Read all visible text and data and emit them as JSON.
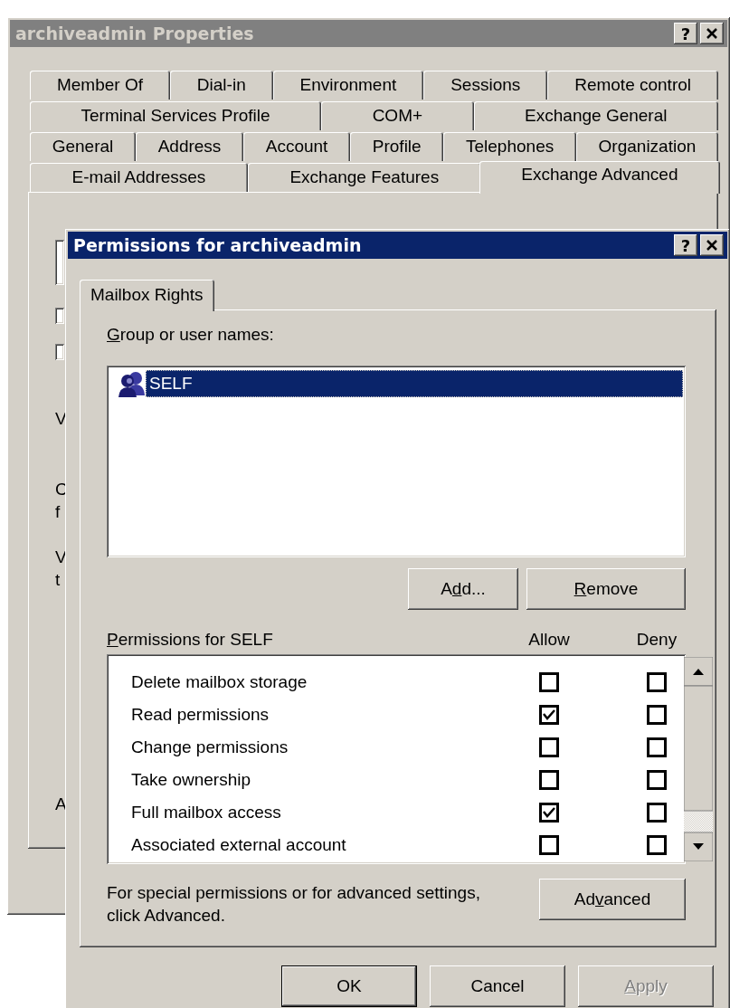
{
  "properties_window": {
    "title": "archiveadmin Properties",
    "active": false,
    "help_button": "?",
    "tab_rows": [
      [
        {
          "label": "Member Of",
          "selected": false
        },
        {
          "label": "Dial-in",
          "selected": false
        },
        {
          "label": "Environment",
          "selected": false
        },
        {
          "label": "Sessions",
          "selected": false
        },
        {
          "label": "Remote control",
          "selected": false
        }
      ],
      [
        {
          "label": "Terminal Services Profile",
          "selected": false
        },
        {
          "label": "COM+",
          "selected": false
        },
        {
          "label": "Exchange General",
          "selected": false
        }
      ],
      [
        {
          "label": "General",
          "selected": false
        },
        {
          "label": "Address",
          "selected": false
        },
        {
          "label": "Account",
          "selected": false
        },
        {
          "label": "Profile",
          "selected": false
        },
        {
          "label": "Telephones",
          "selected": false
        },
        {
          "label": "Organization",
          "selected": false
        }
      ],
      [
        {
          "label": "E-mail Addresses",
          "selected": false
        },
        {
          "label": "Exchange Features",
          "selected": false
        },
        {
          "label": "Exchange Advanced",
          "selected": true
        }
      ]
    ],
    "cut_off_items": [
      {
        "kind": "field"
      },
      {
        "kind": "checkbox",
        "checked": false
      },
      {
        "kind": "checkbox",
        "checked": false
      },
      {
        "kind": "text",
        "lines": [
          "V"
        ]
      },
      {
        "kind": "text",
        "lines": [
          "C",
          "f"
        ]
      },
      {
        "kind": "text",
        "lines": [
          "V",
          "t"
        ]
      },
      {
        "kind": "text",
        "lines": [
          "A"
        ]
      }
    ]
  },
  "permissions_dialog": {
    "title": "Permissions for archiveadmin",
    "active": true,
    "help_button": "?",
    "tabs": [
      {
        "label": "Mailbox Rights",
        "selected": true
      }
    ],
    "group_label": [
      {
        "text": "G",
        "underline": true
      },
      {
        "text": "roup or user names:",
        "underline": false
      }
    ],
    "principals": [
      {
        "name": "SELF",
        "selected": true
      }
    ],
    "principal_buttons": [
      {
        "label": [
          {
            "text": "A",
            "underline": false
          },
          {
            "text": "d",
            "underline": true
          },
          {
            "text": "d...",
            "underline": false
          }
        ]
      },
      {
        "label": [
          {
            "text": "R",
            "underline": true
          },
          {
            "text": "emove",
            "underline": false
          }
        ]
      }
    ],
    "permissions_label": [
      {
        "text": "P",
        "underline": true
      },
      {
        "text": "ermissions for SELF",
        "underline": false
      }
    ],
    "columns": [
      "Allow",
      "Deny"
    ],
    "permissions": [
      {
        "name": "Delete mailbox storage",
        "allow": false,
        "deny": false
      },
      {
        "name": "Read permissions",
        "allow": true,
        "deny": false
      },
      {
        "name": "Change permissions",
        "allow": false,
        "deny": false
      },
      {
        "name": "Take ownership",
        "allow": false,
        "deny": false
      },
      {
        "name": "Full mailbox access",
        "allow": true,
        "deny": false
      },
      {
        "name": "Associated external account",
        "allow": false,
        "deny": false
      }
    ],
    "advanced_note": "For special permissions or for advanced settings, click Advanced.",
    "advanced_button": {
      "label": [
        {
          "text": "Ad",
          "underline": false
        },
        {
          "text": "v",
          "underline": true
        },
        {
          "text": "anced",
          "underline": false
        }
      ]
    },
    "footer_buttons": [
      {
        "label": [
          {
            "text": "OK",
            "underline": false
          }
        ],
        "default": true,
        "disabled": false
      },
      {
        "label": [
          {
            "text": "Cancel",
            "underline": false
          }
        ],
        "default": false,
        "disabled": false
      },
      {
        "label": [
          {
            "text": "A",
            "underline": true
          },
          {
            "text": "pply",
            "underline": false
          }
        ],
        "default": false,
        "disabled": true
      }
    ]
  }
}
